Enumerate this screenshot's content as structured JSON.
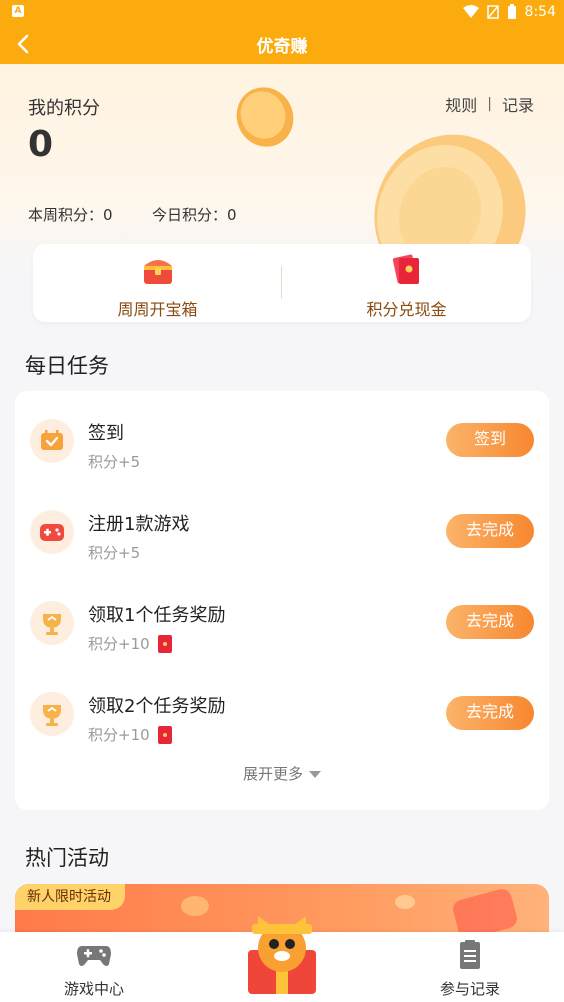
{
  "statusbar": {
    "time": "8:54",
    "app_badge": "A"
  },
  "navbar": {
    "title": "优奇赚"
  },
  "points": {
    "label": "我的积分",
    "value": "0",
    "weekly": "本周积分：0",
    "daily": "今日积分：0",
    "rules": "规则",
    "separator": "|",
    "records": "记录"
  },
  "quick_actions": [
    {
      "label": "周周开宝箱",
      "icon": "treasure-chest-icon"
    },
    {
      "label": "积分兑现金",
      "icon": "red-envelope-icon"
    }
  ],
  "daily_tasks": {
    "title": "每日任务",
    "items": [
      {
        "name": "签到",
        "reward": "积分+5",
        "button": "签到",
        "icon": "calendar-check-icon",
        "red_packet": false
      },
      {
        "name": "注册1款游戏",
        "reward": "积分+5",
        "button": "去完成",
        "icon": "gamepad-icon",
        "red_packet": false
      },
      {
        "name": "领取1个任务奖励",
        "reward": "积分+10",
        "button": "去完成",
        "icon": "trophy-icon",
        "red_packet": true
      },
      {
        "name": "领取2个任务奖励",
        "reward": "积分+10",
        "button": "去完成",
        "icon": "trophy-icon",
        "red_packet": true
      }
    ],
    "expand_label": "展开更多"
  },
  "hot_activities": {
    "title": "热门活动",
    "banner_tag": "新人限时活动"
  },
  "tabbar": {
    "left": "游戏中心",
    "right": "参与记录"
  },
  "colors": {
    "accent": "#fbab0e",
    "button": "#f7872f",
    "text_brown": "#8a4a10"
  }
}
